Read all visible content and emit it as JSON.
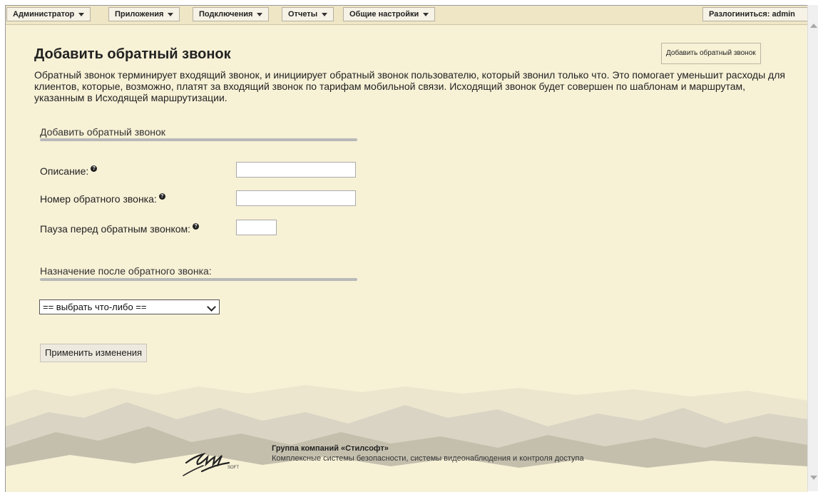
{
  "menu": {
    "items": [
      {
        "label": "Администратор"
      },
      {
        "label": "Приложения"
      },
      {
        "label": "Подключения"
      },
      {
        "label": "Отчеты"
      },
      {
        "label": "Общие настройки"
      }
    ],
    "logout_label": "Разлогиниться: admin"
  },
  "page": {
    "title": "Добавить обратный звонок",
    "add_button_label": "Добавить обратный звонок",
    "description": "Обратный звонок терминирует входящий звонок, и инициирует обратный звонок пользователю, который звонил только что. Это помогает уменьшит расходы для клиентов, которые, возможно, платят за входящий звонок по тарифам мобильной связи. Исходящий звонок будет совершен по шаблонам и маршрутам, указанным в Исходящей маршрутизации."
  },
  "form": {
    "section_title": "Добавить обратный звонок",
    "fields": {
      "description_label": "Описание:",
      "description_value": "",
      "number_label": "Номер обратного звонка:",
      "number_value": "",
      "pause_label": "Пауза перед обратным звонком:",
      "pause_value": ""
    },
    "help_glyph": "?",
    "destination_title": "Назначение после обратного звонка:",
    "destination_select": "== выбрать что-либо ==",
    "apply_label": "Применить изменения"
  },
  "footer": {
    "company": "Группа компаний «Стилсофт»",
    "tagline": "Комплексные системы безопасности, системы видеонаблюдения и контроля доступа",
    "logo_text": "SOFT"
  },
  "colors": {
    "page_bg": "#f7f1d6",
    "menubar_bg": "#efe6c6",
    "mountain_light": "#d9d4c3",
    "mountain_dark": "#b9b4a2"
  },
  "icons": [
    "caret-down-icon",
    "help-icon",
    "chevron-down-icon",
    "scroll-up-icon",
    "scroll-down-icon",
    "stilsoft-logo"
  ]
}
